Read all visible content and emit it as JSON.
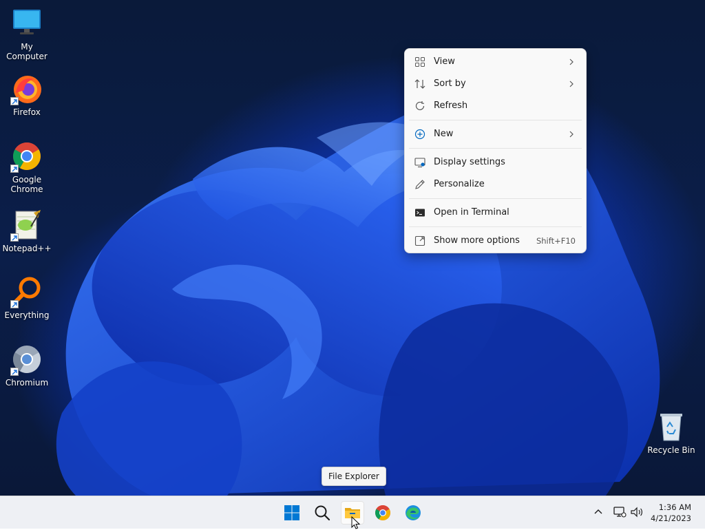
{
  "desktop": {
    "icons": [
      {
        "label": "My Computer",
        "icon": "monitor-icon"
      },
      {
        "label": "Firefox",
        "icon": "firefox-icon"
      },
      {
        "label": "Google Chrome",
        "icon": "chrome-icon"
      },
      {
        "label": "Notepad++",
        "icon": "notepadpp-icon"
      },
      {
        "label": "Everything",
        "icon": "everything-icon"
      },
      {
        "label": "Chromium",
        "icon": "chromium-icon"
      }
    ],
    "recycle_bin": {
      "label": "Recycle Bin",
      "icon": "recycle-bin-icon"
    }
  },
  "context_menu": {
    "items": [
      {
        "label": "View",
        "icon": "grid-view-icon",
        "submenu": true
      },
      {
        "label": "Sort by",
        "icon": "sort-icon",
        "submenu": true
      },
      {
        "label": "Refresh",
        "icon": "refresh-icon"
      },
      {
        "label": "New",
        "icon": "plus-circle-icon",
        "submenu": true
      },
      {
        "label": "Display settings",
        "icon": "display-settings-icon"
      },
      {
        "label": "Personalize",
        "icon": "pencil-icon"
      },
      {
        "label": "Open in Terminal",
        "icon": "terminal-icon"
      },
      {
        "label": "Show more options",
        "icon": "show-more-icon",
        "shortcut": "Shift+F10"
      }
    ]
  },
  "tooltip": {
    "text": "File Explorer"
  },
  "taskbar": {
    "apps": [
      {
        "name": "Start",
        "icon": "windows-start-icon"
      },
      {
        "name": "Search",
        "icon": "search-icon"
      },
      {
        "name": "File Explorer",
        "icon": "folder-icon",
        "active": true
      },
      {
        "name": "Google Chrome",
        "icon": "chrome-icon"
      },
      {
        "name": "Microsoft Edge",
        "icon": "edge-icon"
      }
    ],
    "tray": {
      "icons": [
        "chevron-up-icon",
        "network-icon",
        "volume-icon"
      ],
      "time": "1:36 AM",
      "date": "4/21/2023"
    }
  },
  "colors": {
    "accent": "#0067c0",
    "menu_bg": "#f9f9f9",
    "taskbar_bg": "#eef0f4"
  }
}
